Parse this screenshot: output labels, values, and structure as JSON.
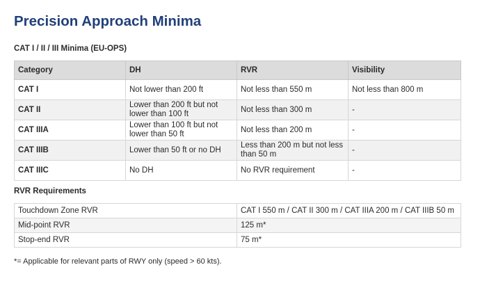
{
  "title": "Precision Approach Minima",
  "minima_section": {
    "heading": "CAT I / II / III Minima (EU-OPS)",
    "columns": [
      "Category",
      "DH",
      "RVR",
      "Visibility"
    ],
    "rows": [
      [
        "CAT I",
        "Not lower than 200 ft",
        "Not less than 550 m",
        "Not less than 800 m"
      ],
      [
        "CAT II",
        "Lower than 200 ft but not lower than 100 ft",
        "Not less than 300 m",
        "-"
      ],
      [
        "CAT IIIA",
        "Lower than 100 ft but not lower than 50 ft",
        "Not less than 200 m",
        "-"
      ],
      [
        "CAT IIIB",
        "Lower than 50 ft or no DH",
        "Less than 200 m but not less than 50 m",
        "-"
      ],
      [
        "CAT IIIC",
        "No DH",
        "No RVR requirement",
        "-"
      ]
    ]
  },
  "rvr_section": {
    "heading": "RVR Requirements",
    "rows": [
      [
        "Touchdown Zone RVR",
        "CAT I 550 m / CAT II 300 m / CAT IIIA 200 m / CAT IIIB 50 m"
      ],
      [
        "Mid-point RVR",
        "125 m*"
      ],
      [
        "Stop-end RVR",
        "75 m*"
      ]
    ]
  },
  "footnote": "*= Applicable for relevant parts of RWY only (speed > 60 kts)."
}
